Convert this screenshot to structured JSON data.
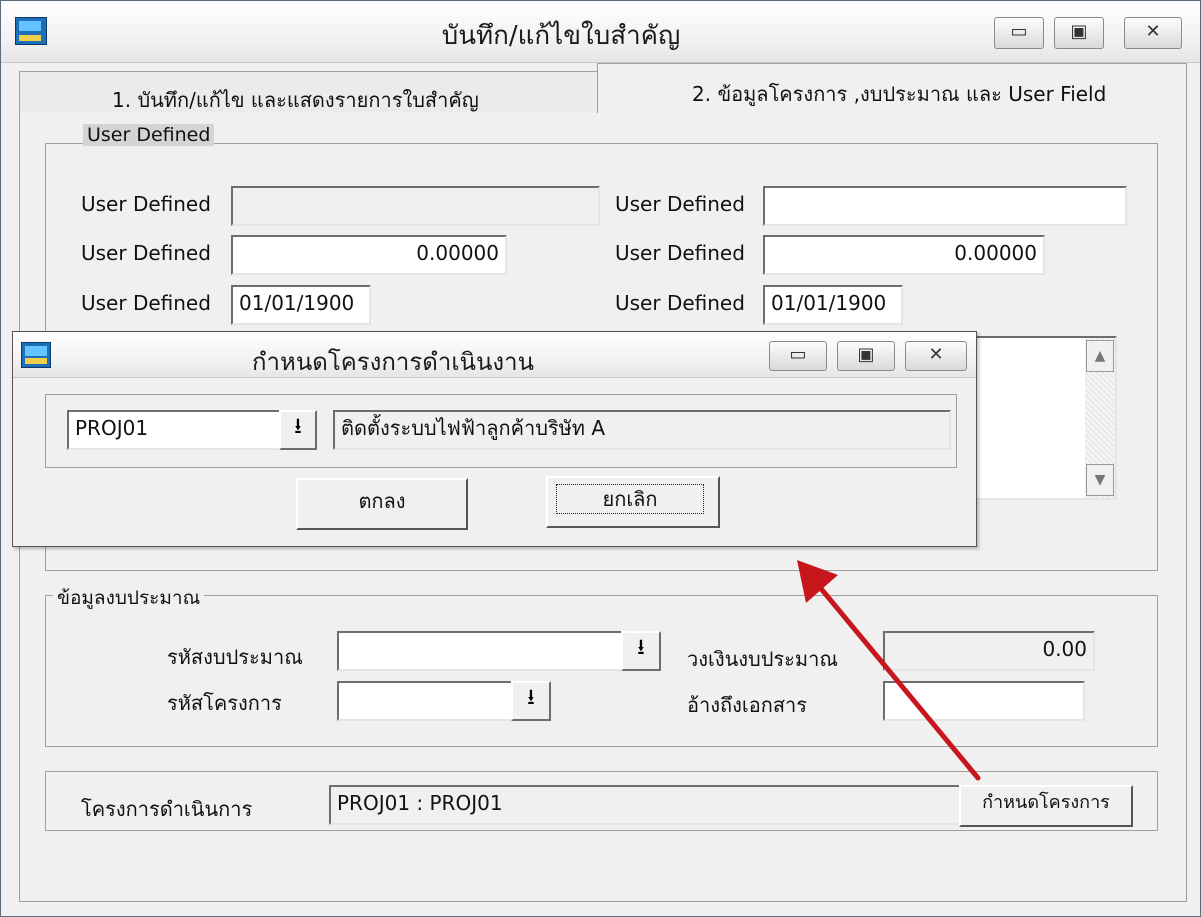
{
  "main_window": {
    "title": "บันทึก/แก้ไขใบสำคัญ",
    "caption_buttons": {
      "minimize": "▭",
      "maximize": "▣",
      "close": "✕"
    },
    "tabs": [
      {
        "label": "1. บันทึก/แก้ไข และแสดงรายการใบสำคัญ"
      },
      {
        "label": "2. ข้อมูลโครงการ ,งบประมาณ และ User Field"
      }
    ],
    "user_defined": {
      "legend": "User Defined",
      "rows": [
        {
          "label_left": "User Defined",
          "value_left": "",
          "label_right": "User Defined",
          "value_right": ""
        },
        {
          "label_left": "User Defined",
          "value_left": "0.00000",
          "label_right": "User Defined",
          "value_right": "0.00000"
        },
        {
          "label_left": "User Defined",
          "value_left": "01/01/1900",
          "label_right": "User Defined",
          "value_right": "01/01/1900"
        }
      ]
    },
    "budget": {
      "legend": "ข้อมูลงบประมาณ",
      "budget_code_label": "รหัสงบประมาณ",
      "budget_code_value": "",
      "project_code_label": "รหัสโครงการ",
      "project_code_value": "",
      "budget_amount_label": "วงเงินงบประมาณ",
      "budget_amount_value": "0.00",
      "reference_label": "อ้างถึงเอกสาร",
      "reference_value": ""
    },
    "operation": {
      "label": "โครงการดำเนินการ",
      "value": "PROJ01 : PROJ01",
      "button": "กำหนดโครงการ"
    }
  },
  "dialog": {
    "title": "กำหนดโครงการดำเนินงาน",
    "project_code": "PROJ01",
    "dropdown_icon": "⭳",
    "project_name": "ติดตั้งระบบไฟฟ้าลูกค้าบริษัท A",
    "ok_button": "ตกลง",
    "cancel_button": "ยกเลิก"
  },
  "annotation": {
    "arrow_color": "#c8171c"
  }
}
